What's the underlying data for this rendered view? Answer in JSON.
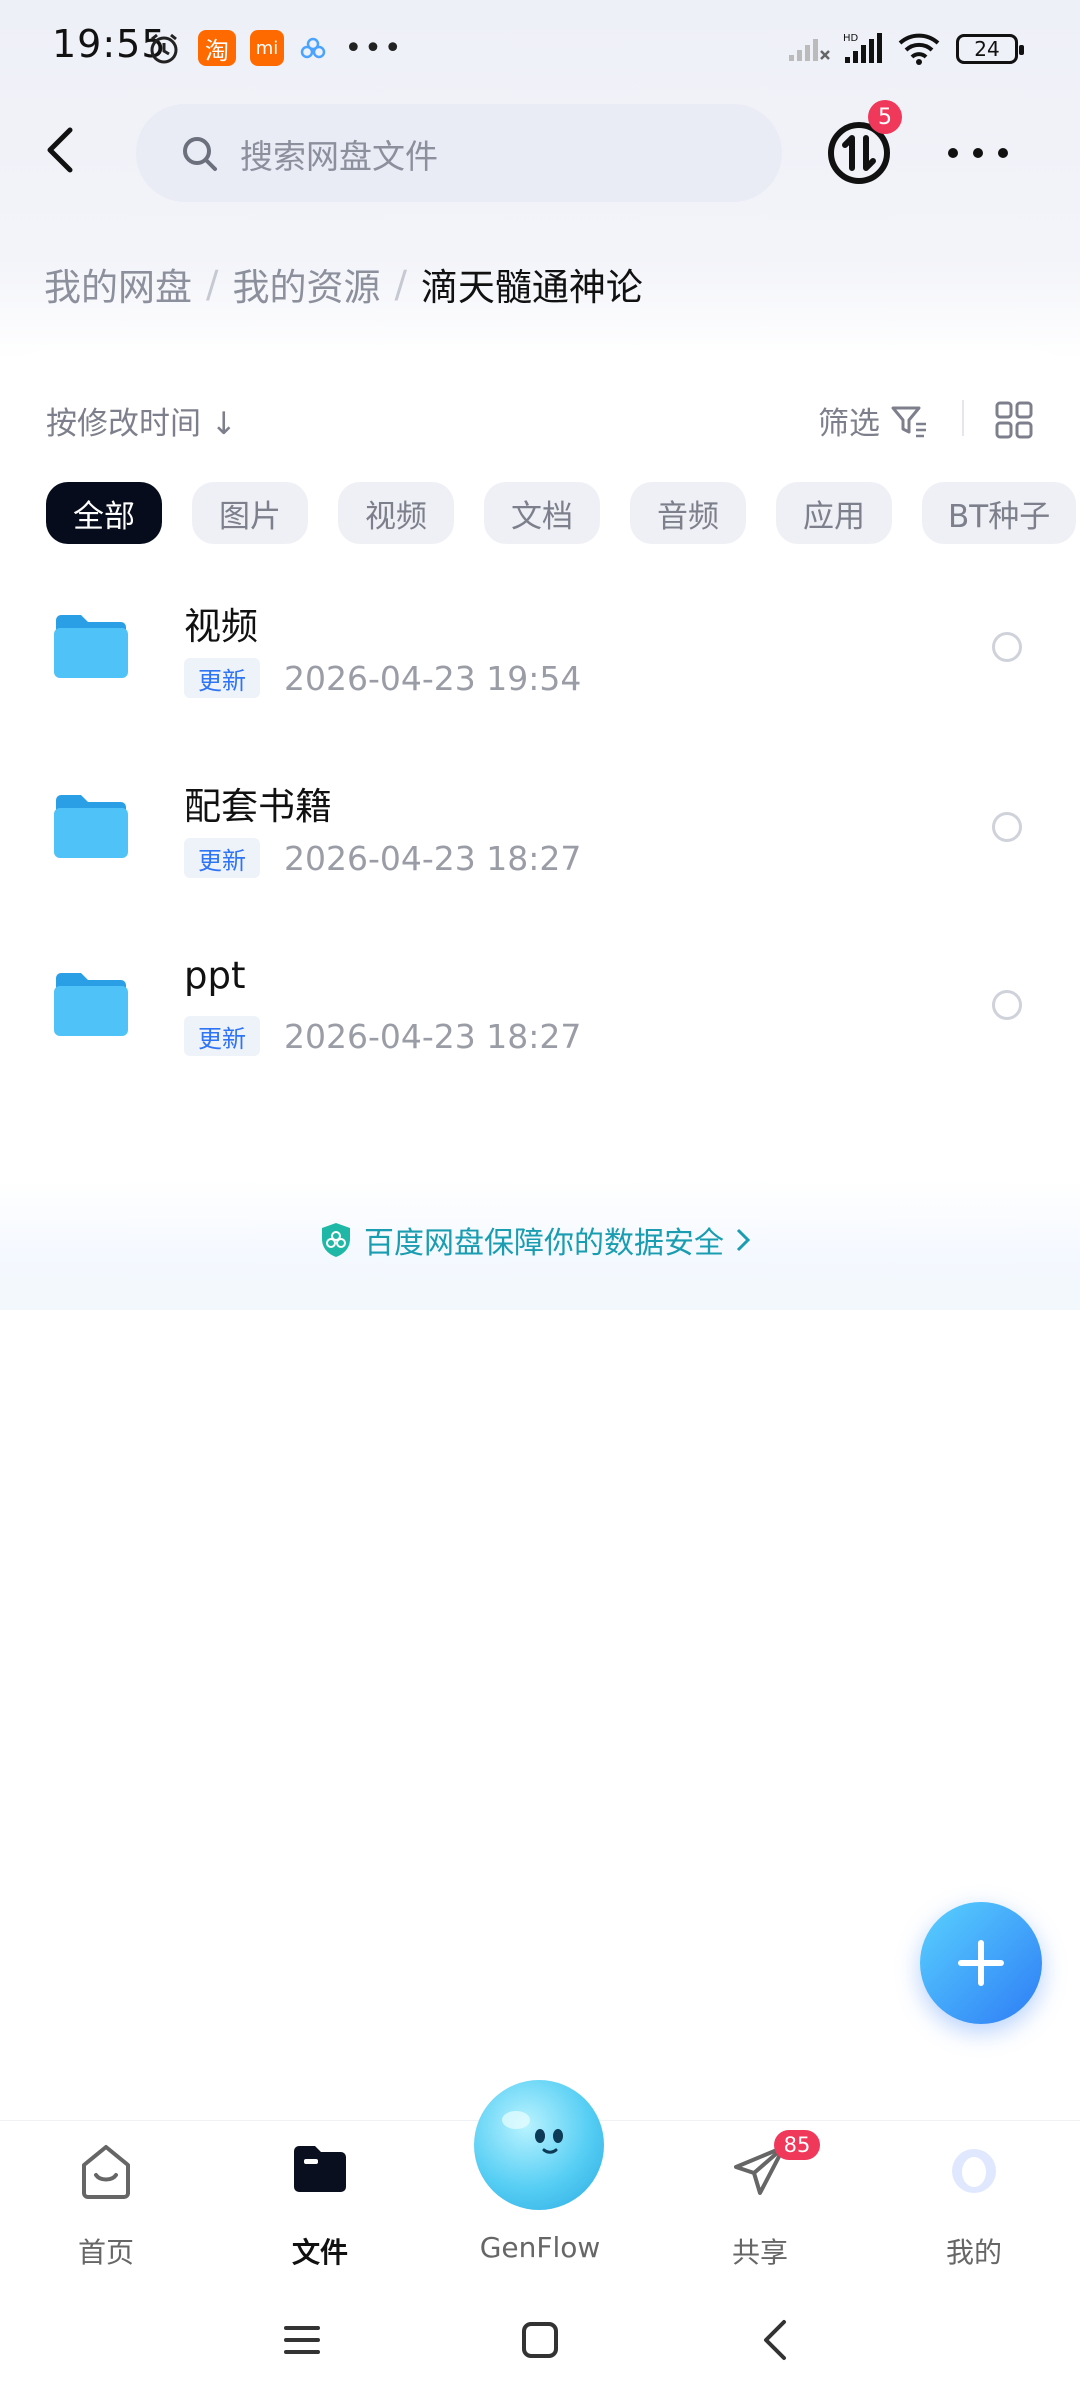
{
  "status_bar": {
    "time": "19:55",
    "battery": "24",
    "notification_icons": [
      "alarm-icon",
      "taobao-icon",
      "mi-icon",
      "baidu-netdisk-icon",
      "more-dots-icon"
    ]
  },
  "header": {
    "search_placeholder": "搜索网盘文件",
    "transfer_badge": "5"
  },
  "breadcrumb": {
    "items": [
      "我的网盘",
      "我的资源"
    ],
    "current": "滴天髓通神论"
  },
  "toolbar": {
    "sort_label": "按修改时间 ↓",
    "filter_label": "筛选"
  },
  "filter_chips": [
    {
      "label": "全部",
      "active": true
    },
    {
      "label": "图片",
      "active": false
    },
    {
      "label": "视频",
      "active": false
    },
    {
      "label": "文档",
      "active": false
    },
    {
      "label": "音频",
      "active": false
    },
    {
      "label": "应用",
      "active": false
    },
    {
      "label": "BT种子",
      "active": false
    }
  ],
  "files": [
    {
      "name": "视频",
      "tag": "更新",
      "modified": "2026-04-23  19:54"
    },
    {
      "name": "配套书籍",
      "tag": "更新",
      "modified": "2026-04-23  18:27"
    },
    {
      "name": "ppt",
      "tag": "更新",
      "modified": "2026-04-23  18:27"
    }
  ],
  "security_note": "百度网盘保障你的数据安全",
  "tabs": [
    {
      "label": "首页",
      "icon": "home-face-icon"
    },
    {
      "label": "文件",
      "icon": "folder-icon",
      "active": true
    },
    {
      "label": "GenFlow",
      "icon": "genflow-bubble-icon"
    },
    {
      "label": "共享",
      "icon": "paper-plane-icon",
      "badge": "85"
    },
    {
      "label": "我的",
      "icon": "avatar-ring-icon"
    }
  ],
  "colors": {
    "accent": "#2f74f5",
    "active_chip": "#060c1c",
    "badge": "#f0385a",
    "folder": "#3fb4f2",
    "security_text": "#1a9db0"
  }
}
